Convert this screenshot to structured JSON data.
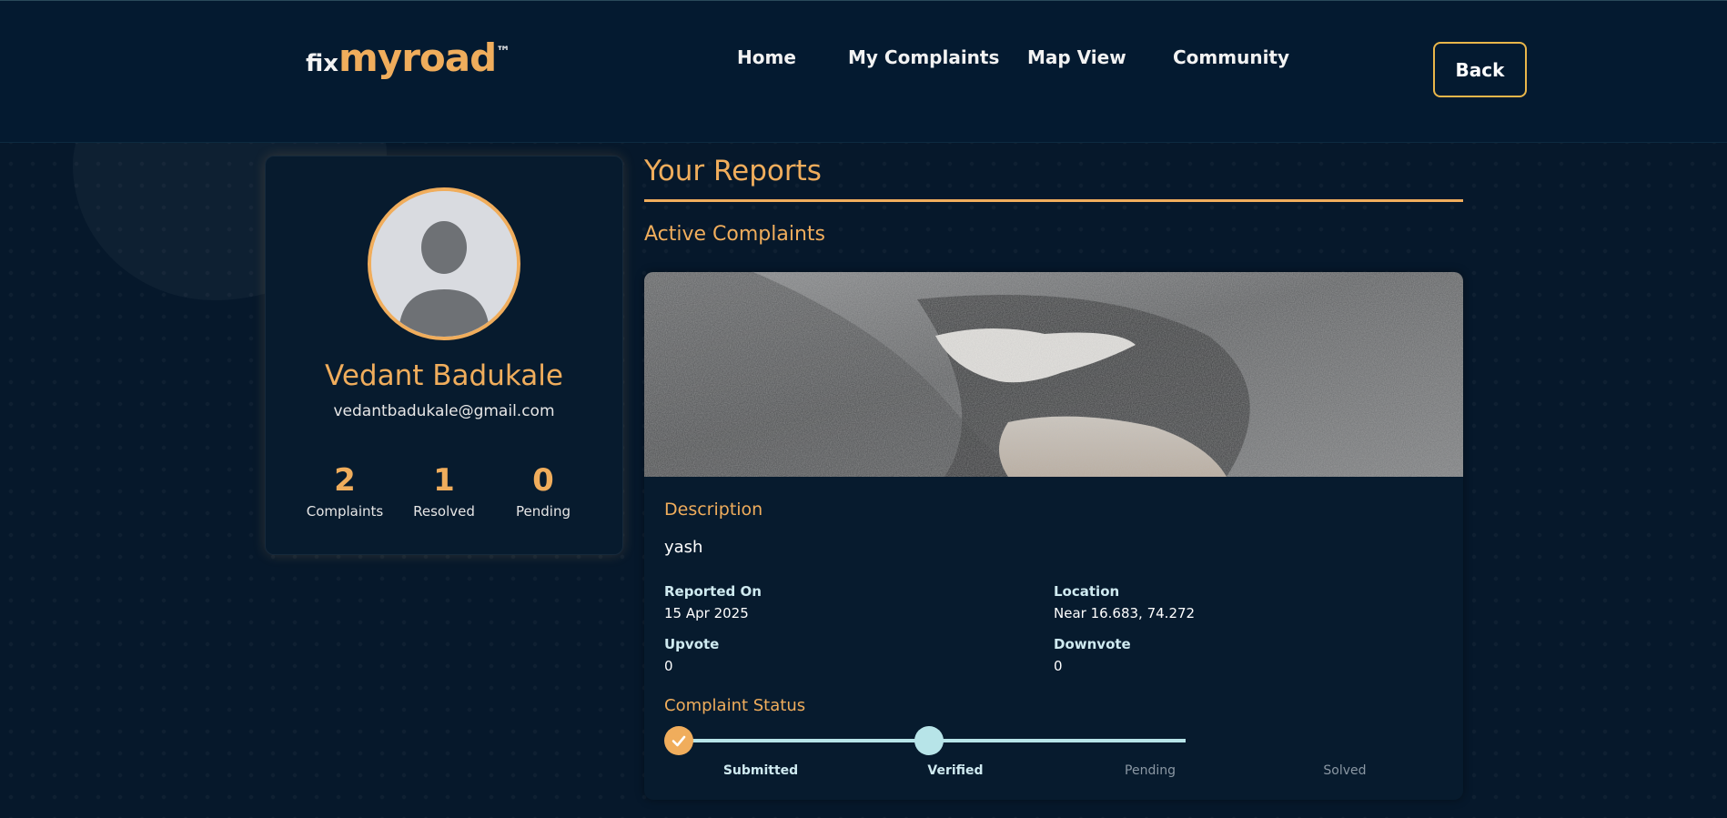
{
  "header": {
    "logo": {
      "prefix": "fix",
      "main": "myroad",
      "tm": "™"
    },
    "nav": [
      "Home",
      "My Complaints",
      "Map View",
      "Community"
    ],
    "back_label": "Back"
  },
  "profile": {
    "name": "Vedant Badukale",
    "email": "vedantbadukale@gmail.com",
    "stats": [
      {
        "value": "2",
        "label": "Complaints"
      },
      {
        "value": "1",
        "label": "Resolved"
      },
      {
        "value": "0",
        "label": "Pending"
      }
    ]
  },
  "reports": {
    "title": "Your Reports",
    "subtitle": "Active Complaints",
    "complaint": {
      "description_title": "Description",
      "description": "yash",
      "reported_on_label": "Reported On",
      "reported_on": "15 Apr 2025",
      "location_label": "Location",
      "location": "Near 16.683, 74.272",
      "upvote_label": "Upvote",
      "upvote": "0",
      "downvote_label": "Downvote",
      "downvote": "0",
      "status_title": "Complaint Status",
      "steps": [
        "Submitted",
        "Verified",
        "Pending",
        "Solved"
      ],
      "completed_steps": 2
    }
  },
  "colors": {
    "accent": "#f0ad5c",
    "background": "#06182b",
    "header": "#041a30",
    "button_border": "#e9b64a",
    "progress": "#b7e4e8"
  }
}
